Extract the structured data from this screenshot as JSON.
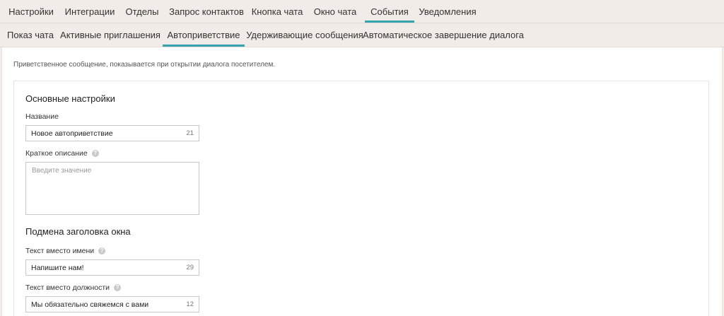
{
  "top_tabs": [
    "Настройки",
    "Интеграции",
    "Отделы",
    "Запрос контактов",
    "Кнопка чата",
    "Окно чата",
    "События",
    "Уведомления"
  ],
  "active_top_tab": "События",
  "sub_tabs": [
    "Показ чата",
    "Активные приглашения",
    "Автоприветствие",
    "Удерживающие сообщения",
    "Автоматическое завершение диалога"
  ],
  "active_sub_tab": "Автоприветствие",
  "intro": "Приветственное сообщение, показывается при открытии диалога посетителем.",
  "basic": {
    "title": "Основные настройки",
    "name_label": "Название",
    "name_value": "Новое автоприветствие",
    "name_counter": "21",
    "desc_label": "Краткое описание",
    "desc_placeholder": "Введите значение"
  },
  "window_title": {
    "title": "Подмена заголовка окна",
    "name_text_label": "Текст вместо имени",
    "name_text_value": "Напишите нам!",
    "name_text_counter": "29",
    "position_text_label": "Текст вместо должности",
    "position_text_value": "Мы обязательно свяжемся с вами",
    "position_text_counter": "12"
  },
  "accent_color": "#33a3ad",
  "help_icon": "?"
}
